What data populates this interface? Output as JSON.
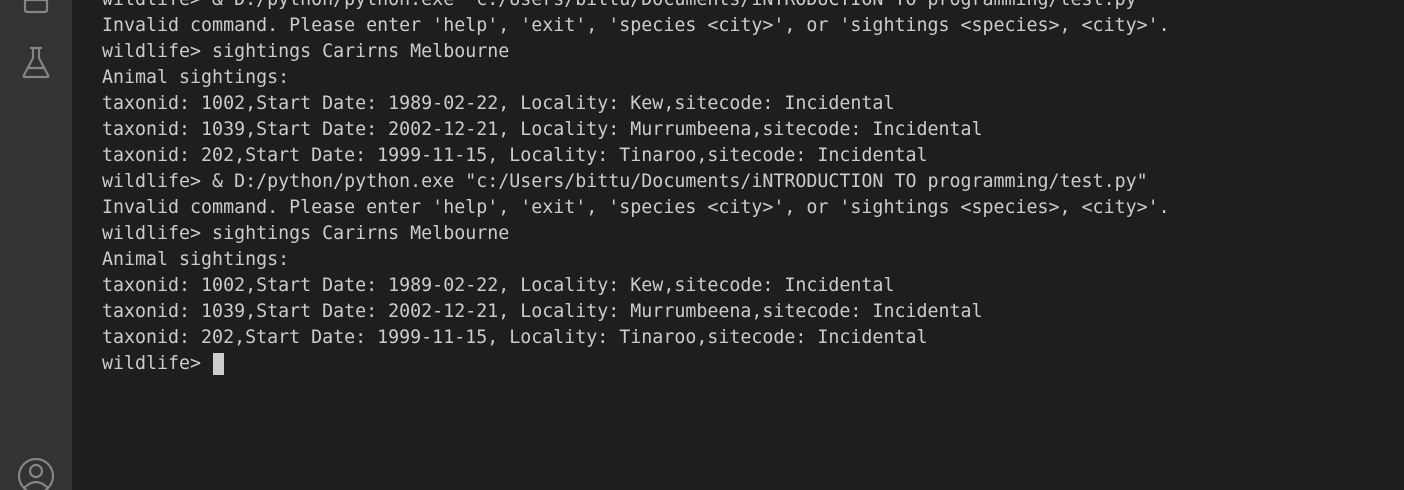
{
  "activity_bar": {
    "icons": [
      "explorer-icon",
      "testing-flask-icon",
      "account-icon"
    ]
  },
  "terminal": {
    "lines": [
      "wildlife> & D:/python/python.exe \"c:/Users/bittu/Documents/iNTRODUCTION TO programming/test.py\"",
      "Invalid command. Please enter 'help', 'exit', 'species <city>', or 'sightings <species>, <city>'.",
      "wildlife> sightings Carirns Melbourne",
      "Animal sightings:",
      "taxonid: 1002,Start Date: 1989-02-22, Locality: Kew,sitecode: Incidental",
      "taxonid: 1039,Start Date: 2002-12-21, Locality: Murrumbeena,sitecode: Incidental",
      "taxonid: 202,Start Date: 1999-11-15, Locality: Tinaroo,sitecode: Incidental",
      "wildlife> & D:/python/python.exe \"c:/Users/bittu/Documents/iNTRODUCTION TO programming/test.py\"",
      "Invalid command. Please enter 'help', 'exit', 'species <city>', or 'sightings <species>, <city>'.",
      "wildlife> sightings Carirns Melbourne",
      "Animal sightings:",
      "taxonid: 1002,Start Date: 1989-02-22, Locality: Kew,sitecode: Incidental",
      "taxonid: 1039,Start Date: 2002-12-21, Locality: Murrumbeena,sitecode: Incidental",
      "taxonid: 202,Start Date: 1999-11-15, Locality: Tinaroo,sitecode: Incidental"
    ],
    "prompt": "wildlife> ",
    "colors": {
      "background": "#1e1e1e",
      "text": "#cccccc",
      "activity_bar": "#333333",
      "icon": "#858585"
    }
  }
}
